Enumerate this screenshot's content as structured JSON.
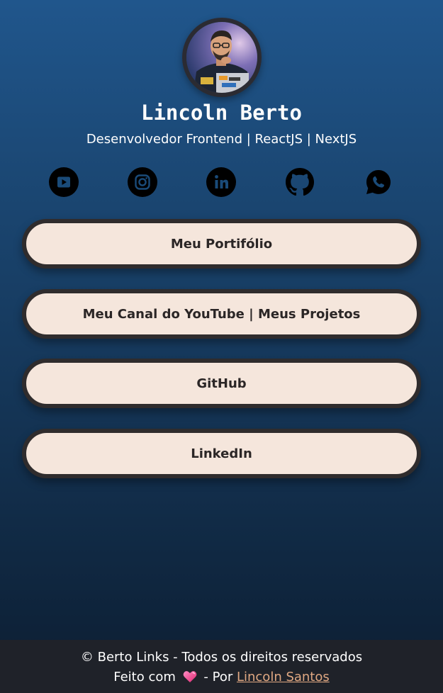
{
  "profile": {
    "name": "Lincoln Berto",
    "subtitle": "Desenvolvedor Frontend | ReactJS | NextJS",
    "avatar_alt": "Lincoln Berto"
  },
  "socials": [
    {
      "icon": "youtube-icon"
    },
    {
      "icon": "instagram-icon"
    },
    {
      "icon": "linkedin-icon"
    },
    {
      "icon": "github-icon"
    },
    {
      "icon": "whatsapp-icon"
    }
  ],
  "links": [
    {
      "label": "Meu Portifólio"
    },
    {
      "label": "Meu Canal do YouTube | Meus Projetos"
    },
    {
      "label": "GitHub"
    },
    {
      "label": "LinkedIn"
    }
  ],
  "footer": {
    "copyright": "© Berto Links - Todos os direitos reservados",
    "made_with": "Feito com",
    "by": "- Por",
    "author": "Lincoln Santos"
  },
  "colors": {
    "background_top": "#20568c",
    "background_bottom": "#0c1d31",
    "button_bg": "#f5e6dc",
    "button_border": "#2f2c2d",
    "footer_bg": "#1f2229",
    "footer_link": "#e0a882"
  }
}
